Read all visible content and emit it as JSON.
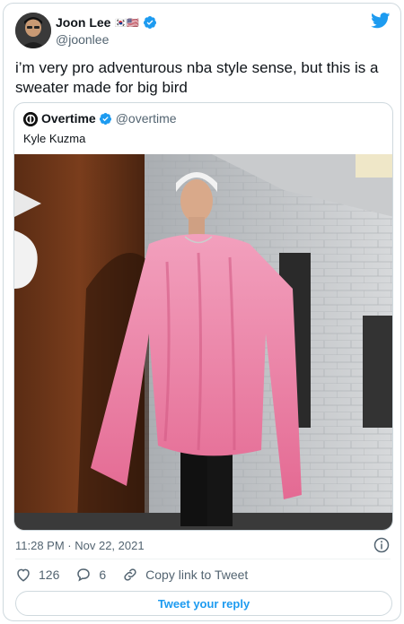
{
  "tweet": {
    "author": {
      "display_name": "Joon Lee",
      "name_emoji": "🇰🇷🇺🇸",
      "handle": "@joonlee",
      "verified": true
    },
    "text": "i’m very pro adventurous nba style sense, but this is a sweater made for big bird",
    "timestamp": "11:28 PM · Nov 22, 2021",
    "likes": "126",
    "replies": "6",
    "copy_link_label": "Copy link to Tweet",
    "reply_button_label": "Tweet your reply"
  },
  "quoted": {
    "display_name": "Overtime",
    "handle": "@overtime",
    "verified": true,
    "text": "Kyle Kuzma"
  },
  "colors": {
    "brand_blue": "#1d9bf0",
    "text_primary": "#0f1419",
    "text_secondary": "#536471",
    "border": "#cfd9de",
    "sweater_pink": "#e8749a"
  },
  "icons": {
    "twitter_logo": "twitter-bird-icon",
    "verified": "verified-badge-icon",
    "info": "info-icon",
    "like": "heart-icon",
    "reply": "speech-bubble-icon",
    "copy_link": "link-icon"
  }
}
